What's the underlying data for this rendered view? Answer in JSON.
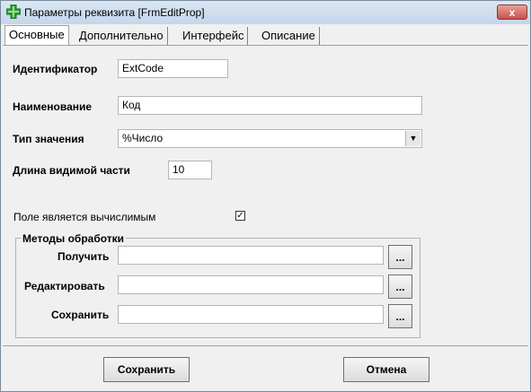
{
  "window": {
    "title": "Параметры реквизита [FrmEditProp]",
    "close_label": "x"
  },
  "tabs": [
    {
      "label": "Основные"
    },
    {
      "label": "Дополнительно"
    },
    {
      "label": "Интерфейс"
    },
    {
      "label": "Описание"
    }
  ],
  "form": {
    "identifier": {
      "label": "Идентификатор",
      "value": "ExtCode"
    },
    "name": {
      "label": "Наименование",
      "value": "Код"
    },
    "value_type": {
      "label": "Тип значения",
      "value": "%Число"
    },
    "visible_length": {
      "label": "Длина видимой части",
      "value": "10"
    },
    "computed": {
      "label": "Поле является вычислимым",
      "checked": true,
      "mark": "✓"
    }
  },
  "methods": {
    "title": "Методы обработки",
    "get": {
      "label": "Получить",
      "value": "",
      "browse": "..."
    },
    "edit": {
      "label": "Редактировать",
      "value": "",
      "browse": "..."
    },
    "save": {
      "label": "Сохранить",
      "value": "",
      "browse": "..."
    }
  },
  "footer": {
    "save_label": "Сохранить",
    "cancel_label": "Отмена"
  }
}
